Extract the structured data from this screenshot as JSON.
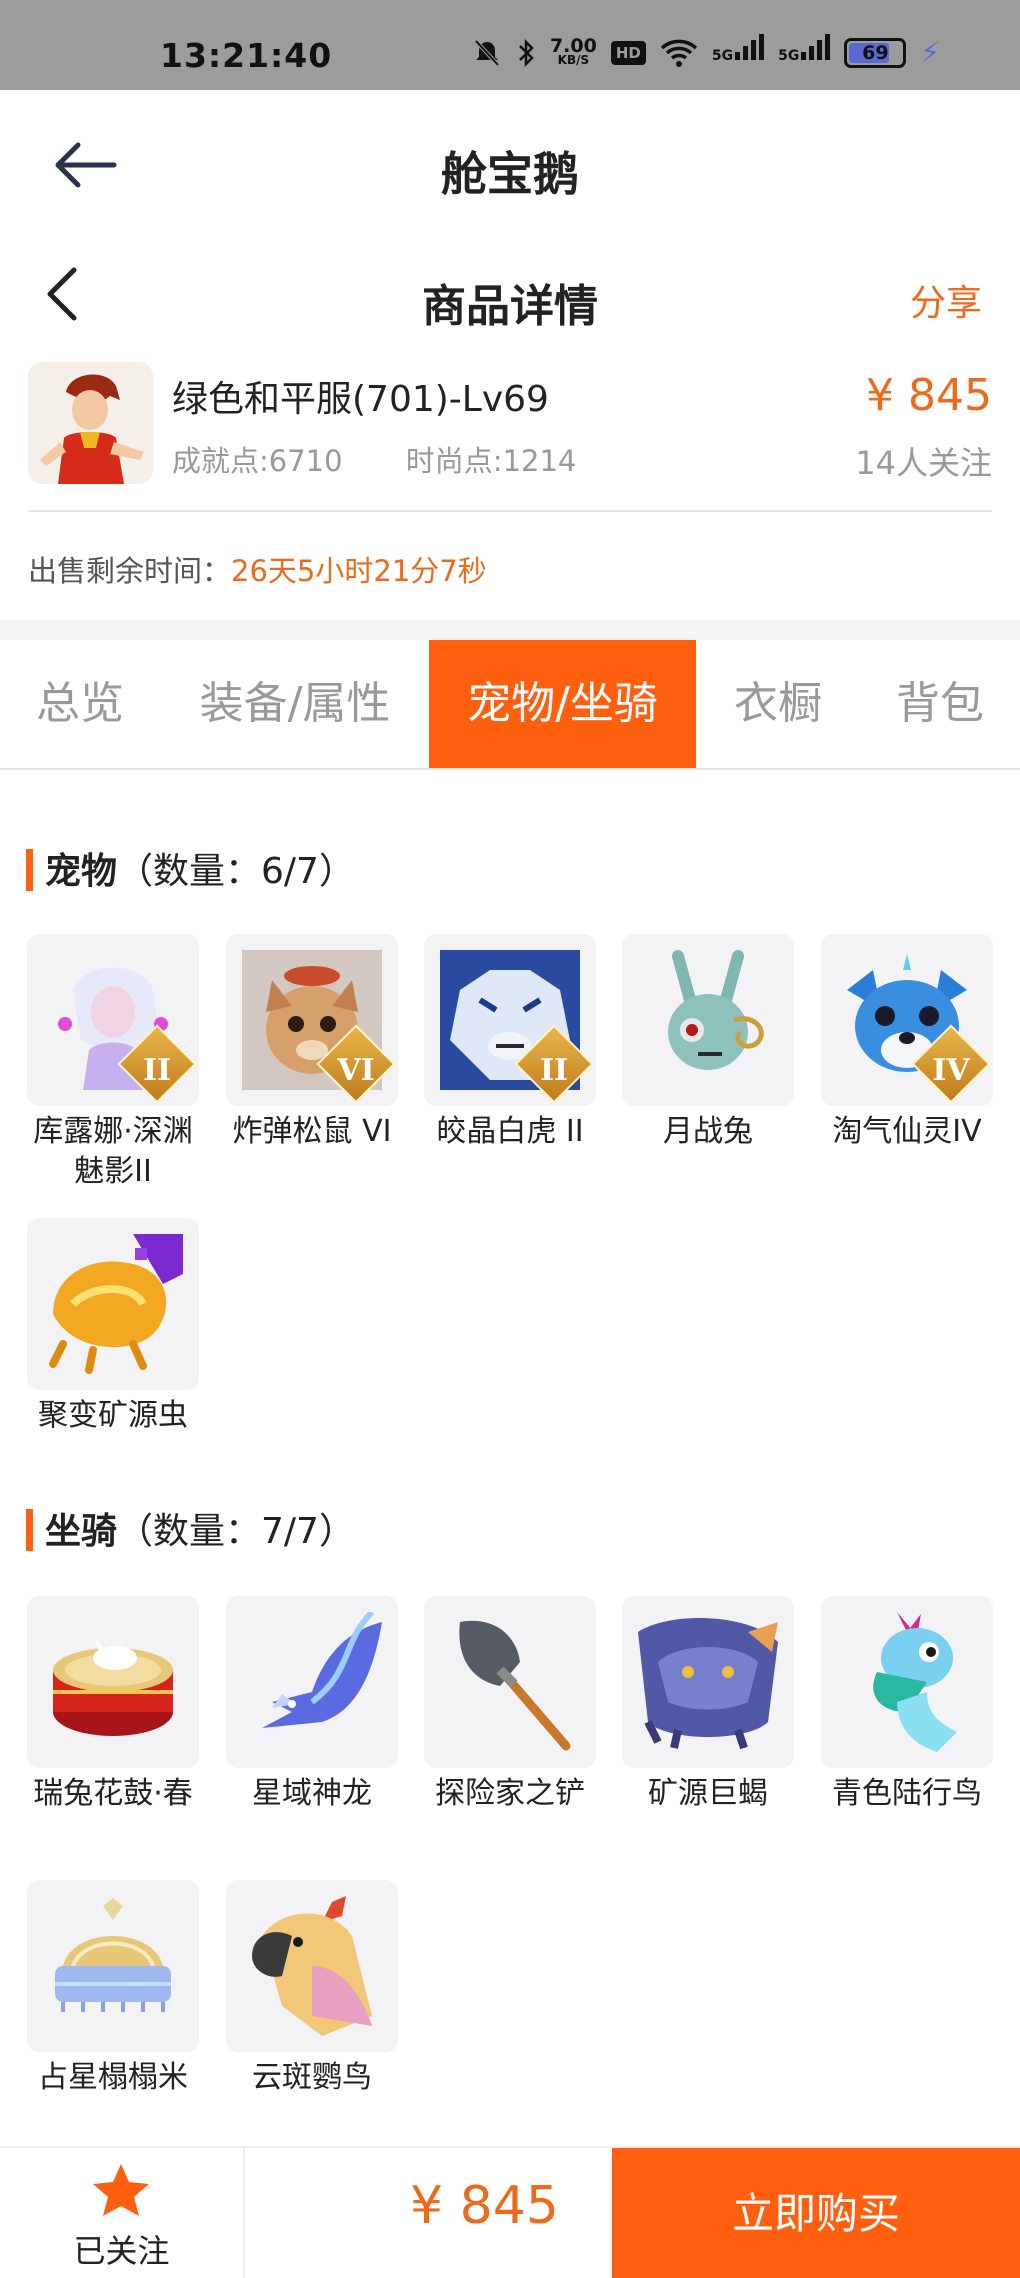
{
  "status_bar": {
    "time": "13:21:40",
    "net_speed_value": "7.00",
    "net_speed_unit": "KB/S",
    "hd": "HD",
    "sim1": "5G",
    "sim2": "5G",
    "battery": "69",
    "icons": [
      "mute-icon",
      "bluetooth-icon",
      "wifi-icon",
      "charging-icon"
    ]
  },
  "appbar": {
    "title": "舱宝鹅"
  },
  "subheader": {
    "title": "商品详情",
    "share": "分享"
  },
  "product": {
    "name": "绿色和平服(701)-Lv69",
    "achievement": "成就点:6710",
    "fashion": "时尚点:1214",
    "price": "¥ 845",
    "followers": "14人关注"
  },
  "remaining": {
    "label": "出售剩余时间：",
    "value": "26天5小时21分7秒"
  },
  "tabs": [
    "总览",
    "装备/属性",
    "宠物/坐骑",
    "衣橱",
    "背包"
  ],
  "active_tab": "宠物/坐骑",
  "pets": {
    "title": "宠物",
    "count": "（数量：6/7）",
    "items": [
      {
        "name": "库露娜·深渊魅影II",
        "badge": "II"
      },
      {
        "name": "炸弹松鼠 VI",
        "badge": "VI"
      },
      {
        "name": "皎晶白虎 II",
        "badge": "II"
      },
      {
        "name": "月战兔",
        "badge": ""
      },
      {
        "name": "淘气仙灵IV",
        "badge": "IV"
      },
      {
        "name": "聚变矿源虫",
        "badge": ""
      }
    ]
  },
  "mounts": {
    "title": "坐骑",
    "count": "（数量：7/7）",
    "items": [
      {
        "name": "瑞兔花鼓·春"
      },
      {
        "name": "星域神龙"
      },
      {
        "name": "探险家之铲"
      },
      {
        "name": "矿源巨蝎"
      },
      {
        "name": "青色陆行鸟"
      },
      {
        "name": "占星榻榻米"
      },
      {
        "name": "云斑鹦鸟"
      }
    ]
  },
  "bottom_bar": {
    "follow_label": "已关注",
    "price": "¥ 845",
    "buy_label": "立即购买"
  },
  "colors": {
    "accent": "#ff5f0f",
    "price": "#ee6a1a",
    "status_bar": "#9c9c9c"
  }
}
